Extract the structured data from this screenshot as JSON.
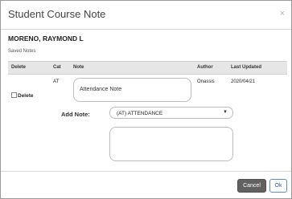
{
  "dialog": {
    "title": "Student Course Note",
    "close_glyph": "×"
  },
  "student": {
    "name": "MORENO, RAYMOND L"
  },
  "saved_notes": {
    "label": "Saved Notes",
    "columns": [
      "Delete",
      "Cat",
      "Note",
      "Author",
      "Last Updated"
    ],
    "rows": [
      {
        "delete_label": "Delete",
        "cat": "AT",
        "note": "Attendance Note",
        "author": "Onassis",
        "last_updated": "2020/04/21"
      }
    ]
  },
  "add_note": {
    "label": "Add Note:",
    "selected": "(AT) ATTENDANCE",
    "caret": "▼",
    "text": ""
  },
  "buttons": {
    "cancel": "Cancel",
    "ok": "Ok"
  }
}
